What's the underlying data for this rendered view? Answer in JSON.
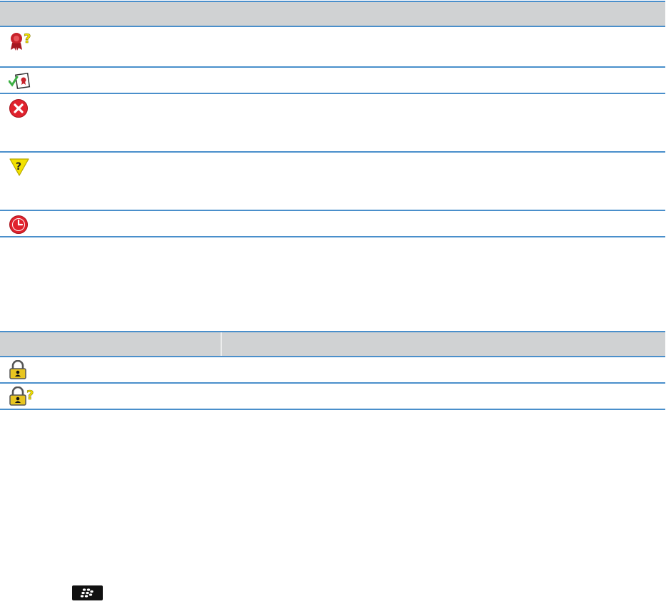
{
  "colors": {
    "rule": "#4a8fcb",
    "header_fill": "#d0d2d3",
    "cert_red": "#c8232b",
    "question_yellow": "#f2e100",
    "check_green": "#3cb043",
    "error_red": "#e0222d",
    "lock_gold": "#e8c520"
  },
  "table1": {
    "rows": [
      {
        "icon": "certificate-question-icon"
      },
      {
        "icon": "certificate-verified-icon"
      },
      {
        "icon": "error-x-icon"
      },
      {
        "icon": "warning-question-triangle-icon"
      },
      {
        "icon": "expired-clock-icon"
      }
    ]
  },
  "table2": {
    "rows": [
      {
        "icon": "lock-icon"
      },
      {
        "icon": "lock-question-icon"
      }
    ]
  },
  "footer": {
    "icon": "blackberry-menu-key-icon"
  }
}
